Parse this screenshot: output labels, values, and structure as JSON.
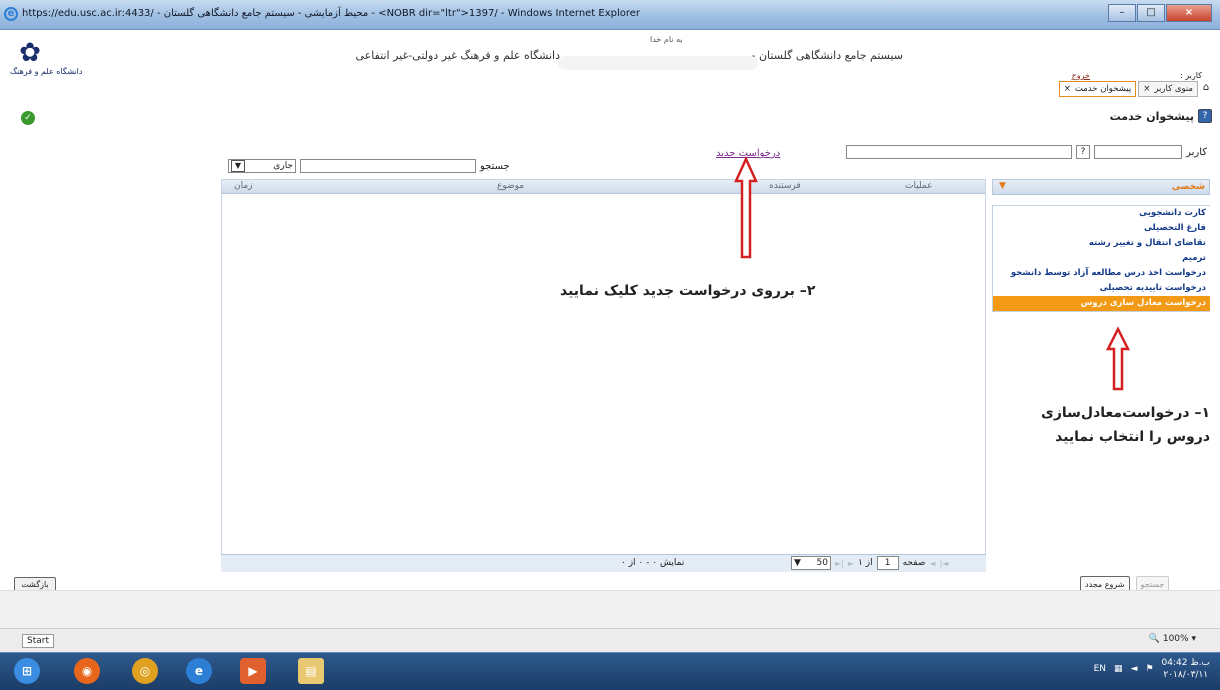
{
  "window": {
    "title": "https://edu.usc.ac.ir:4433/ - محیط آزمایشی - سیستم جامع دانشگاهی گلستان - <NOBR dir=\"ltr\">1397/ - Windows Internet Explorer"
  },
  "header": {
    "by_name": "به نام خدا",
    "system_title": "سیستم جامع دانشگاهی گلستان -",
    "uni_name": "دانشگاه علم و فرهنگ غیر دولتی-غیر انتفاعی",
    "logo_caption": "دانشگاه علم و فرهنگ",
    "user_label": "کاربر :",
    "exit_link": "خروج"
  },
  "tabs": [
    {
      "label": "منوی کاربر",
      "close": "×"
    },
    {
      "label": "پیشخوان خدمت",
      "close": "×"
    }
  ],
  "service": {
    "title": "پیشخوان خدمت",
    "help": "?"
  },
  "filter": {
    "user_label": "کاربر",
    "qbtn": "?"
  },
  "new_request": "درخواست جدید",
  "search": {
    "label": "جستجو",
    "status_value": "جاری",
    "arrow": "▼"
  },
  "grid": {
    "columns": [
      "عملیات",
      "فرستنده",
      "موضوع",
      "زمان"
    ]
  },
  "footer": {
    "display": "نمایش ۰ - ۰ از ۰",
    "page_size": "50",
    "page_label": "صفحه",
    "page_num": "1",
    "of_label": "از ۱"
  },
  "menu": {
    "header": "شخصی",
    "items": [
      "کارت دانشجویی",
      "فارغ التحصیلی",
      "تقاضای انتقال و تغییر رشته",
      "ترمیم",
      "درخواست اخذ درس مطالعه آزاد توسط دانشجو",
      "درخواست تاییدیه تحصیلی",
      "درخواست معادل سازی دروس"
    ]
  },
  "annotations": {
    "step2": "۲– برروی درخواست جدید کلیک نمایید",
    "step1_line1": "۱– درخواست‌معادل‌سازی",
    "step1_line2": "دروس را انتخاب نمایید"
  },
  "buttons": {
    "back": "بازگشت",
    "restart": "شروع مجدد",
    "search": "جستجو"
  },
  "status": {
    "start": "Start",
    "zoom": "100%"
  },
  "taskbar": {
    "lang": "EN",
    "time": "04:42 ب.ظ",
    "date": "۲۰۱۸/۰۳/۱۱"
  }
}
